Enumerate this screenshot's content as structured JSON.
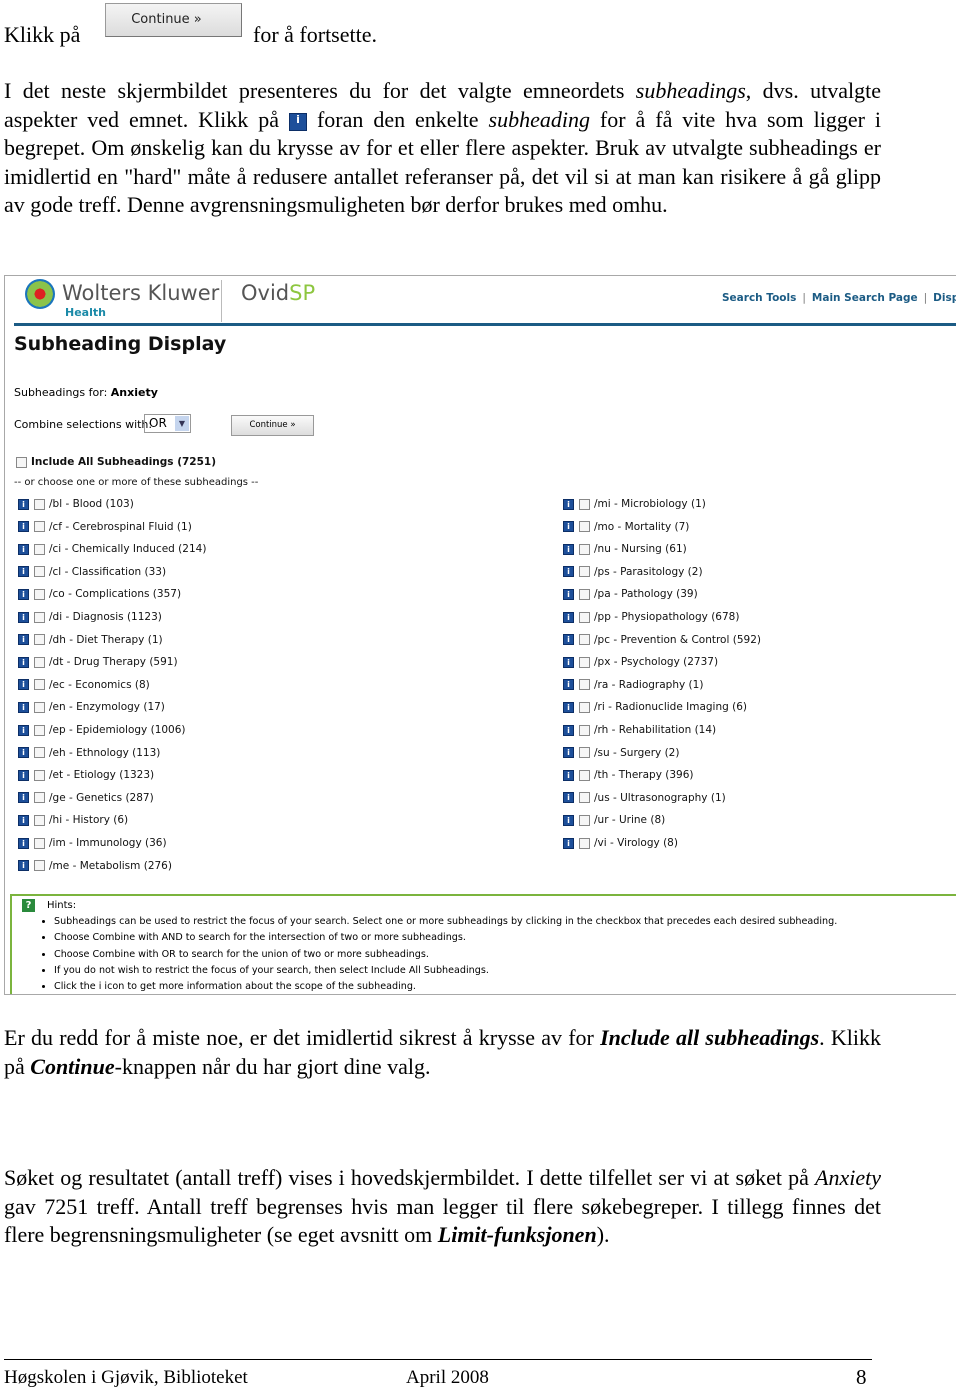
{
  "intro": {
    "before": "Klikk på",
    "button_label": "Continue »",
    "after": "for å fortsette."
  },
  "para1": {
    "a": "I det neste skjermbildet presenteres du for det valgte emneordets ",
    "b": "subheadings",
    "c": ", dvs. utvalgte aspekter ved emnet. Klikk på ",
    "icon": "info-icon",
    "d": " foran den enkelte ",
    "e": "subheading",
    "f": " for å få vite hva som ligger i begrepet. Om ønskelig kan du krysse av for et eller flere aspekter. Bruk av utvalgte subheadings er imidlertid en \"hard\" måte å redusere antallet referanser på, det vil si at man kan risikere å gå glipp av gode treff. Denne avgrensningsmuligheten bør derfor brukes med omhu."
  },
  "screenshot": {
    "logo": {
      "brand": "Wolters Kluwer",
      "sub": "Health",
      "product_a": "Ovid",
      "product_b": "SP"
    },
    "nav": [
      "Search Tools",
      "Main Search Page",
      "Display"
    ],
    "title": "Subheading Display",
    "subheadings_for_label": "Subheadings for:",
    "subheadings_for_value": "Anxiety",
    "combine_label": "Combine selections with:",
    "combine_value": "OR",
    "continue_label": "Continue »",
    "include_all": "Include All Subheadings (7251)",
    "choose_label": "-- or choose one or more of these subheadings --",
    "left": [
      "/bl - Blood (103)",
      "/cf - Cerebrospinal Fluid (1)",
      "/ci - Chemically Induced (214)",
      "/cl - Classification (33)",
      "/co - Complications (357)",
      "/di - Diagnosis (1123)",
      "/dh - Diet Therapy (1)",
      "/dt - Drug Therapy (591)",
      "/ec - Economics (8)",
      "/en - Enzymology (17)",
      "/ep - Epidemiology (1006)",
      "/eh - Ethnology (113)",
      "/et - Etiology (1323)",
      "/ge - Genetics (287)",
      "/hi - History (6)",
      "/im - Immunology (36)",
      "/me - Metabolism (276)"
    ],
    "right": [
      "/mi - Microbiology (1)",
      "/mo - Mortality (7)",
      "/nu - Nursing (61)",
      "/ps - Parasitology (2)",
      "/pa - Pathology (39)",
      "/pp - Physiopathology (678)",
      "/pc - Prevention & Control (592)",
      "/px - Psychology (2737)",
      "/ra - Radiography (1)",
      "/ri - Radionuclide Imaging (6)",
      "/rh - Rehabilitation (14)",
      "/su - Surgery (2)",
      "/th - Therapy (396)",
      "/us - Ultrasonography (1)",
      "/ur - Urine (8)",
      "/vi - Virology (8)"
    ],
    "hints_title": "Hints:",
    "hints": [
      "Subheadings can be used to restrict the focus of your search. Select one or more subheadings by clicking in the checkbox that precedes each desired subheading.",
      "Choose Combine with AND to search for the intersection of two or more subheadings.",
      "Choose Combine with OR to search for the union of two or more subheadings.",
      "If you do not wish to restrict the focus of your search, then select Include All Subheadings.",
      "Click the i icon to get more information about the scope of the subheading."
    ],
    "colors": {
      "nav_blue": "#1b5b84",
      "hint_green": "#7bb43e",
      "info_blue": "#1d4f9a"
    }
  },
  "para2": {
    "a": "Er du redd for å miste noe, er det imidlertid sikrest å krysse av for ",
    "b": "Include all subheadings",
    "c": ". Klikk på ",
    "d": "Continue",
    "e": "-knappen når du har gjort dine valg."
  },
  "para3": {
    "a": "Søket og resultatet (antall treff) vises i hovedskjermbildet. I dette tilfellet ser vi at søket på ",
    "b": "Anxiety",
    "c": " gav 7251 treff. Antall treff begrenses hvis man legger til flere søkebegreper. I tillegg finnes det flere begrensningsmuligheter (se eget avsnitt om ",
    "d": "Limit-funksjonen",
    "e": ")."
  },
  "footer": {
    "left": "Høgskolen i Gjøvik, Biblioteket",
    "center": "April 2008",
    "page": "8"
  }
}
